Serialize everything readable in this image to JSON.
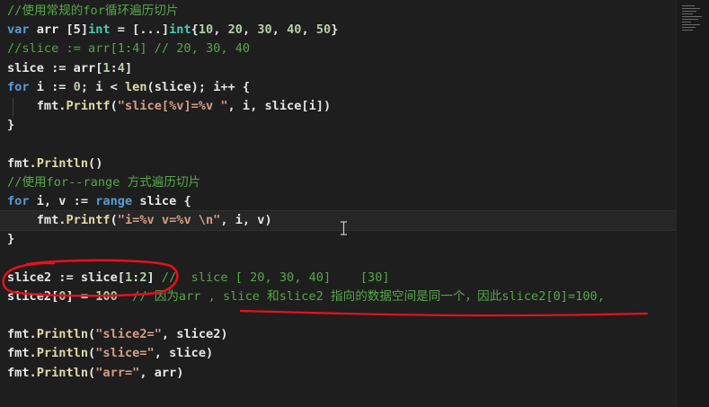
{
  "editor": {
    "lines": [
      [
        {
          "t": "//使用常规的for循环遍历切片",
          "c": "c"
        }
      ],
      [
        {
          "t": "var ",
          "c": "k"
        },
        {
          "t": "arr ",
          "c": "p"
        },
        {
          "t": "[5]",
          "c": "p"
        },
        {
          "t": "int",
          "c": "t"
        },
        {
          "t": " = [...]",
          "c": "p"
        },
        {
          "t": "int",
          "c": "t"
        },
        {
          "t": "{",
          "c": "p"
        },
        {
          "t": "10",
          "c": "n"
        },
        {
          "t": ", ",
          "c": "p"
        },
        {
          "t": "20",
          "c": "n"
        },
        {
          "t": ", ",
          "c": "p"
        },
        {
          "t": "30",
          "c": "n"
        },
        {
          "t": ", ",
          "c": "p"
        },
        {
          "t": "40",
          "c": "n"
        },
        {
          "t": ", ",
          "c": "p"
        },
        {
          "t": "50",
          "c": "n"
        },
        {
          "t": "}",
          "c": "p"
        }
      ],
      [
        {
          "t": "//slice := arr[1:4] // 20, 30, 40",
          "c": "c"
        }
      ],
      [
        {
          "t": "slice := arr[",
          "c": "p"
        },
        {
          "t": "1",
          "c": "n"
        },
        {
          "t": ":",
          "c": "p"
        },
        {
          "t": "4",
          "c": "n"
        },
        {
          "t": "]",
          "c": "p"
        }
      ],
      [
        {
          "t": "for ",
          "c": "k"
        },
        {
          "t": "i := ",
          "c": "p"
        },
        {
          "t": "0",
          "c": "n"
        },
        {
          "t": "; i < ",
          "c": "p"
        },
        {
          "t": "len",
          "c": "f"
        },
        {
          "t": "(slice); i++ {",
          "c": "p"
        }
      ],
      [
        {
          "t": "    fmt.",
          "c": "p"
        },
        {
          "t": "Printf",
          "c": "f"
        },
        {
          "t": "(",
          "c": "p"
        },
        {
          "t": "\"slice[%v]=%v \"",
          "c": "s"
        },
        {
          "t": ", i, slice[i])",
          "c": "p"
        }
      ],
      [
        {
          "t": "}",
          "c": "p"
        }
      ],
      [
        {
          "t": "",
          "c": "p"
        }
      ],
      [
        {
          "t": "fmt.",
          "c": "p"
        },
        {
          "t": "Println",
          "c": "f"
        },
        {
          "t": "()",
          "c": "p"
        }
      ],
      [
        {
          "t": "//使用for--range 方式遍历切片",
          "c": "c"
        }
      ],
      [
        {
          "t": "for ",
          "c": "k"
        },
        {
          "t": "i, v := ",
          "c": "p"
        },
        {
          "t": "range ",
          "c": "k"
        },
        {
          "t": "slice {",
          "c": "p"
        }
      ],
      [
        {
          "t": "    fmt.",
          "c": "p"
        },
        {
          "t": "Printf",
          "c": "f"
        },
        {
          "t": "(",
          "c": "p"
        },
        {
          "t": "\"i=%v v=%v \\n\"",
          "c": "s"
        },
        {
          "t": ", i, v)",
          "c": "p"
        }
      ],
      [
        {
          "t": "}",
          "c": "p"
        }
      ],
      [
        {
          "t": "",
          "c": "p"
        }
      ],
      [
        {
          "t": "slice2 := slice[",
          "c": "p"
        },
        {
          "t": "1",
          "c": "n"
        },
        {
          "t": ":",
          "c": "p"
        },
        {
          "t": "2",
          "c": "n"
        },
        {
          "t": "] ",
          "c": "p"
        },
        {
          "t": "//  slice [ 20, 30, 40]    [30]",
          "c": "c"
        }
      ],
      [
        {
          "t": "slice2[",
          "c": "p"
        },
        {
          "t": "0",
          "c": "n"
        },
        {
          "t": "] = ",
          "c": "p"
        },
        {
          "t": "100",
          "c": "n"
        },
        {
          "t": "  ",
          "c": "p"
        },
        {
          "t": "// 因为arr , slice 和slice2 指向的数据空间是同一个，因此slice2[0]=100,",
          "c": "c"
        }
      ],
      [
        {
          "t": "",
          "c": "p"
        }
      ],
      [
        {
          "t": "fmt.",
          "c": "p"
        },
        {
          "t": "Println",
          "c": "f"
        },
        {
          "t": "(",
          "c": "p"
        },
        {
          "t": "\"slice2=\"",
          "c": "s"
        },
        {
          "t": ", slice2)",
          "c": "p"
        }
      ],
      [
        {
          "t": "fmt.",
          "c": "p"
        },
        {
          "t": "Println",
          "c": "f"
        },
        {
          "t": "(",
          "c": "p"
        },
        {
          "t": "\"slice=\"",
          "c": "s"
        },
        {
          "t": ", slice)",
          "c": "p"
        }
      ],
      [
        {
          "t": "fmt.",
          "c": "p"
        },
        {
          "t": "Println",
          "c": "f"
        },
        {
          "t": "(",
          "c": "p"
        },
        {
          "t": "\"arr=\"",
          "c": "s"
        },
        {
          "t": ", arr)",
          "c": "p"
        }
      ]
    ],
    "current_line": 11
  },
  "colors": {
    "background": "#1e1e1e",
    "comment": "#57a64a",
    "keyword": "#569cd6",
    "type": "#4ec9b0",
    "number": "#b5cea8",
    "string": "#d69d85",
    "function": "#dcdcaa",
    "annotation": "#e8101a"
  },
  "icons": {
    "cursor": "text-ibeam-icon"
  }
}
